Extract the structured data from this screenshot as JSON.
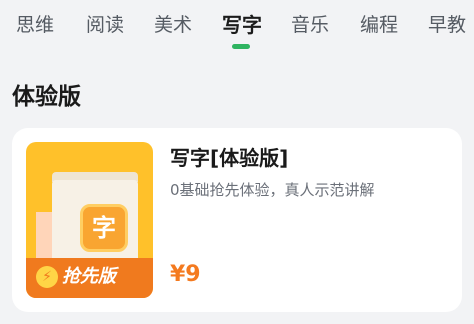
{
  "tabs": [
    {
      "label": "思维"
    },
    {
      "label": "阅读"
    },
    {
      "label": "美术"
    },
    {
      "label": "写字"
    },
    {
      "label": "音乐"
    },
    {
      "label": "编程"
    },
    {
      "label": "早教"
    }
  ],
  "active_tab": "写字",
  "colors": {
    "accent": "#2fb461",
    "price": "#f47a1f",
    "cover_bg": "#ffc12a",
    "ribbon": "#f07a1e"
  },
  "section": {
    "title": "体验版"
  },
  "course_card": {
    "title": "写字[体验版]",
    "subtitle": "0基础抢先体验，真人示范讲解",
    "price": "¥9",
    "cover": {
      "char": "字",
      "ribbon_label": "抢先版",
      "ribbon_icon": "lightning-icon"
    }
  }
}
